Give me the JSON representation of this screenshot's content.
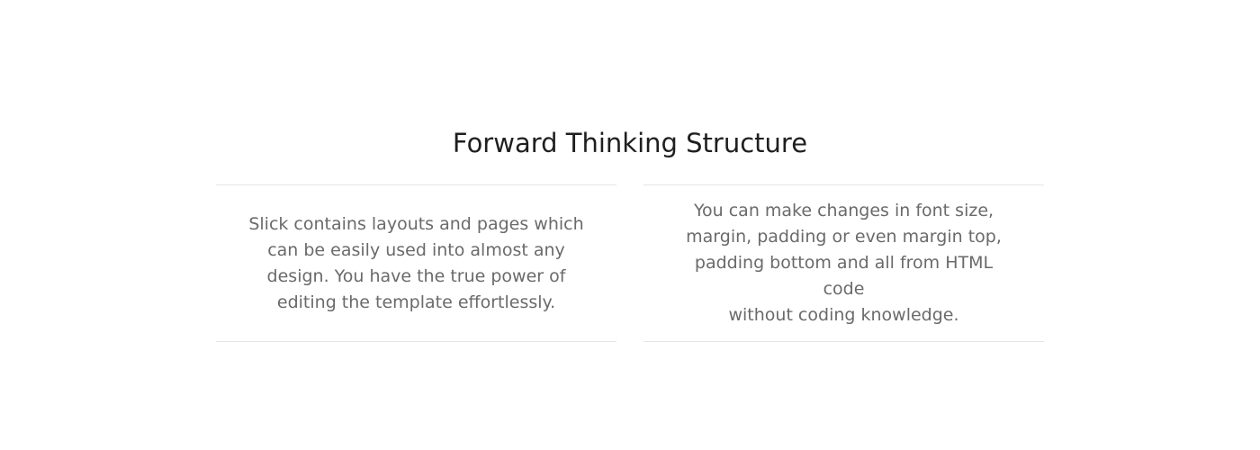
{
  "section": {
    "title": "Forward Thinking Structure",
    "columns": [
      {
        "lines": [
          "Slick contains layouts and pages which",
          "can be easily used into almost any",
          "design. You have the true power of",
          "editing the template effortlessly."
        ]
      },
      {
        "lines": [
          "You can make changes in font size,",
          "margin, padding or even margin top,",
          "padding bottom and all from HTML code",
          "without coding knowledge."
        ]
      }
    ]
  },
  "colors": {
    "background": "#ffffff",
    "title": "#1f1f1f",
    "body_text": "#6a6a6a",
    "divider": "#e6e6e6"
  }
}
